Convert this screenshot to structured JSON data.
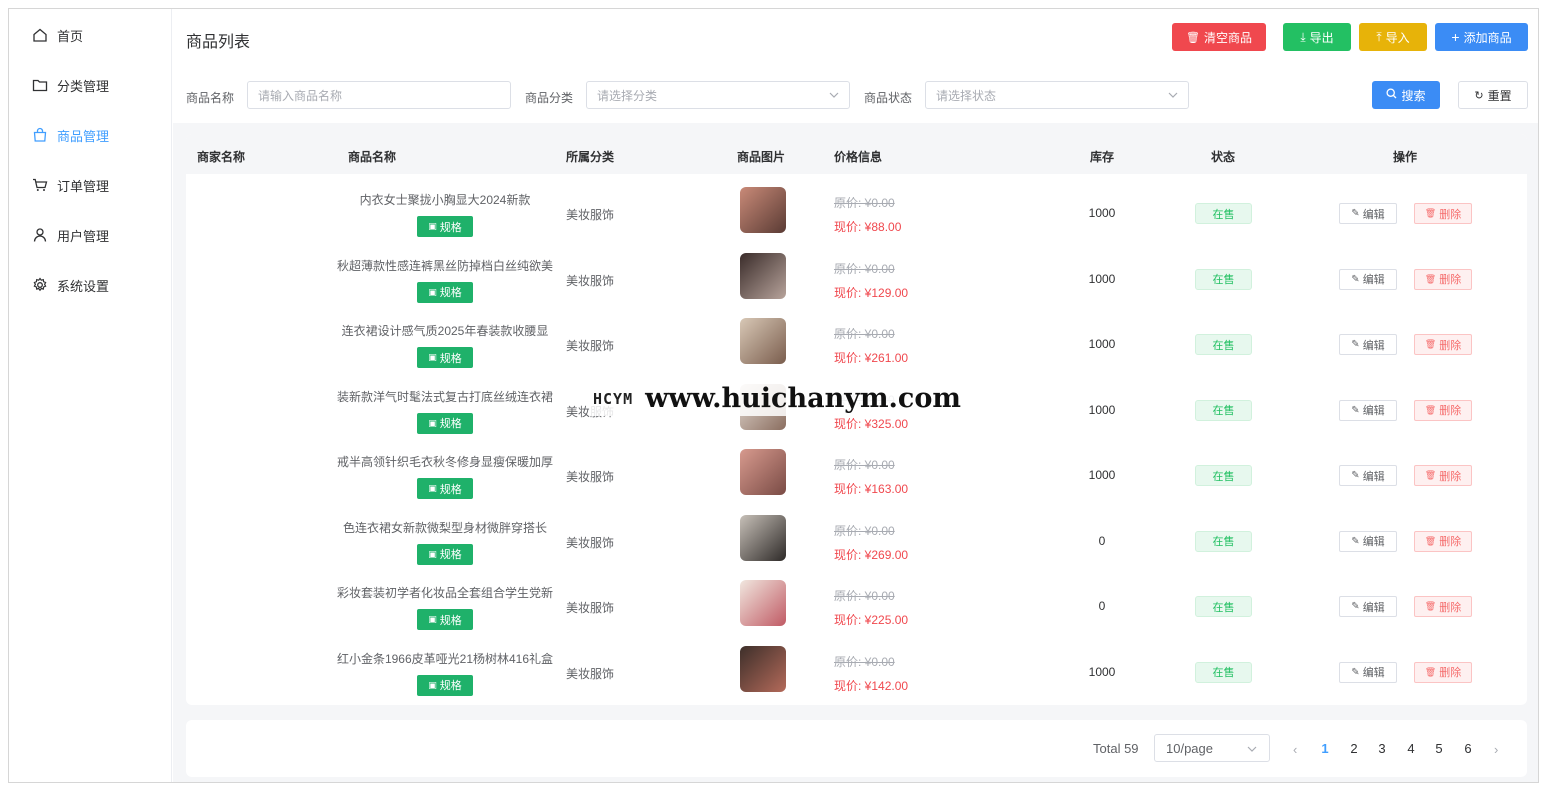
{
  "sidebar": {
    "items": [
      {
        "label": "首页",
        "icon": "home-icon",
        "active": false
      },
      {
        "label": "分类管理",
        "icon": "folder-icon",
        "active": false
      },
      {
        "label": "商品管理",
        "icon": "shopping-bag-icon",
        "active": true
      },
      {
        "label": "订单管理",
        "icon": "cart-icon",
        "active": false
      },
      {
        "label": "用户管理",
        "icon": "user-icon",
        "active": false
      },
      {
        "label": "系统设置",
        "icon": "gear-icon",
        "active": false
      }
    ]
  },
  "header": {
    "title": "商品列表",
    "buttons": {
      "clear": "清空商品",
      "export": "导出",
      "import": "导入",
      "add": "添加商品"
    }
  },
  "filters": {
    "name_label": "商品名称",
    "name_placeholder": "请输入商品名称",
    "category_label": "商品分类",
    "category_placeholder": "请选择分类",
    "status_label": "商品状态",
    "status_placeholder": "请选择状态",
    "search": "搜索",
    "reset": "重置"
  },
  "table": {
    "columns": [
      "商家名称",
      "商品名称",
      "所属分类",
      "商品图片",
      "价格信息",
      "库存",
      "状态",
      "操作"
    ],
    "spec_label": "规格",
    "edit_label": "编辑",
    "delete_label": "删除",
    "rows": [
      {
        "merchant": "",
        "name": "内衣女士聚拢小胸显大2024新款",
        "category": "美妆服饰",
        "orig_price": "原价: ¥0.00",
        "price": "现价: ¥88.00",
        "stock": "1000",
        "status": "在售"
      },
      {
        "merchant": "",
        "name": "秋超薄款性感连裤黑丝防掉档白丝纯欲美",
        "category": "美妆服饰",
        "orig_price": "原价: ¥0.00",
        "price": "现价: ¥129.00",
        "stock": "1000",
        "status": "在售"
      },
      {
        "merchant": "",
        "name": "连衣裙设计感气质2025年春装款收腰显",
        "category": "美妆服饰",
        "orig_price": "原价: ¥0.00",
        "price": "现价: ¥261.00",
        "stock": "1000",
        "status": "在售"
      },
      {
        "merchant": "",
        "name": "装新款洋气时髦法式复古打底丝绒连衣裙",
        "category": "美妆服饰",
        "orig_price": "原价: ¥0.00",
        "price": "现价: ¥325.00",
        "stock": "1000",
        "status": "在售"
      },
      {
        "merchant": "",
        "name": "戒半高领针织毛衣秋冬修身显瘦保暖加厚",
        "category": "美妆服饰",
        "orig_price": "原价: ¥0.00",
        "price": "现价: ¥163.00",
        "stock": "1000",
        "status": "在售"
      },
      {
        "merchant": "",
        "name": "色连衣裙女新款微梨型身材微胖穿搭长",
        "category": "美妆服饰",
        "orig_price": "原价: ¥0.00",
        "price": "现价: ¥269.00",
        "stock": "0",
        "status": "在售"
      },
      {
        "merchant": "",
        "name": "彩妆套装初学者化妆品全套组合学生党新",
        "category": "美妆服饰",
        "orig_price": "原价: ¥0.00",
        "price": "现价: ¥225.00",
        "stock": "0",
        "status": "在售"
      },
      {
        "merchant": "",
        "name": "红小金条1966皮革哑光21杨树林416礼盒",
        "category": "美妆服饰",
        "orig_price": "原价: ¥0.00",
        "price": "现价: ¥142.00",
        "stock": "1000",
        "status": "在售"
      }
    ]
  },
  "pagination": {
    "total": "Total 59",
    "page_size": "10/page",
    "pages": [
      "1",
      "2",
      "3",
      "4",
      "5",
      "6"
    ],
    "current": "1"
  },
  "watermark": {
    "logo": "HCYM",
    "url": "www.huichanym.com"
  },
  "colors": {
    "accent": "#409eff",
    "danger": "#f0484e",
    "success": "#23c063",
    "warning": "#e7b309",
    "primary": "#3b8cf5"
  }
}
